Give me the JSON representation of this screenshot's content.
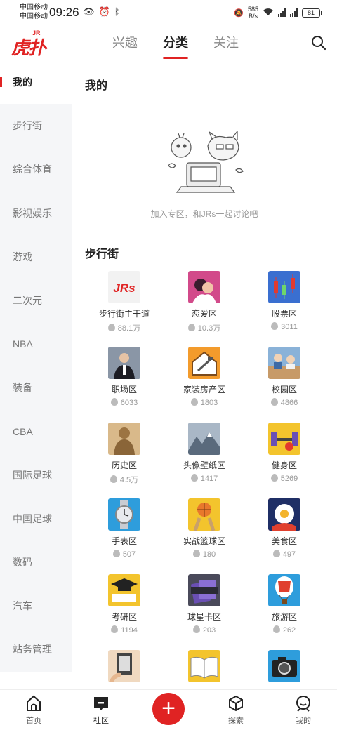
{
  "status": {
    "carrier1": "中国移动",
    "carrier2": "中国移动",
    "time": "09:26",
    "speed_value": "585",
    "speed_unit": "B/s",
    "battery": "81"
  },
  "topnav": {
    "logo_text": "虎扑",
    "logo_badge": "JR",
    "tabs": [
      "兴趣",
      "分类",
      "关注"
    ],
    "active_tab": "分类"
  },
  "sidebar": {
    "items": [
      "我的",
      "步行街",
      "综合体育",
      "影视娱乐",
      "游戏",
      "二次元",
      "NBA",
      "装备",
      "CBA",
      "国际足球",
      "中国足球",
      "数码",
      "汽车",
      "站务管理"
    ]
  },
  "mine": {
    "title": "我的",
    "empty_text": "加入专区，和JRs一起讨论吧"
  },
  "section": {
    "title": "步行街",
    "items": [
      {
        "name": "步行街主干道",
        "count": "88.1万",
        "icon": "jrs-logo-icon",
        "color": "#f2f2f2"
      },
      {
        "name": "恋爱区",
        "count": "10.3万",
        "icon": "love-couple-icon",
        "color": "#d24a8a"
      },
      {
        "name": "股票区",
        "count": "3011",
        "icon": "stock-candles-icon",
        "color": "#3a6fd0"
      },
      {
        "name": "职场区",
        "count": "6033",
        "icon": "office-man-icon",
        "color": "#6b7a8f"
      },
      {
        "name": "家装房产区",
        "count": "1803",
        "icon": "house-tools-icon",
        "color": "#f39b2c"
      },
      {
        "name": "校园区",
        "count": "4866",
        "icon": "classroom-icon",
        "color": "#8ab2d8"
      },
      {
        "name": "历史区",
        "count": "4.5万",
        "icon": "terracotta-warrior-icon",
        "color": "#b88a4a"
      },
      {
        "name": "头像壁纸区",
        "count": "1417",
        "icon": "mountain-wallpaper-icon",
        "color": "#7e8fa3"
      },
      {
        "name": "健身区",
        "count": "5269",
        "icon": "barbell-icon",
        "color": "#f3c42d"
      },
      {
        "name": "手表区",
        "count": "507",
        "icon": "watch-icon",
        "color": "#2e9ddc"
      },
      {
        "name": "实战篮球区",
        "count": "180",
        "icon": "basketball-icon",
        "color": "#f3c42d"
      },
      {
        "name": "美食区",
        "count": "497",
        "icon": "fried-egg-icon",
        "color": "#e0402e"
      },
      {
        "name": "考研区",
        "count": "1194",
        "icon": "graduation-cap-icon",
        "color": "#f3c42d"
      },
      {
        "name": "球星卡区",
        "count": "203",
        "icon": "trading-card-icon",
        "color": "#4a4a5a"
      },
      {
        "name": "旅游区",
        "count": "262",
        "icon": "hot-air-balloon-icon",
        "color": "#2e9ddc"
      },
      {
        "name": "",
        "count": "",
        "icon": "ereader-icon",
        "color": "#f0d9c0"
      },
      {
        "name": "",
        "count": "",
        "icon": "open-book-icon",
        "color": "#f3c42d"
      },
      {
        "name": "",
        "count": "",
        "icon": "camera-icon",
        "color": "#2e9ddc"
      }
    ]
  },
  "bottomnav": {
    "items": [
      "首页",
      "社区",
      "探索",
      "我的"
    ],
    "active": "社区",
    "post_symbol": "+"
  }
}
